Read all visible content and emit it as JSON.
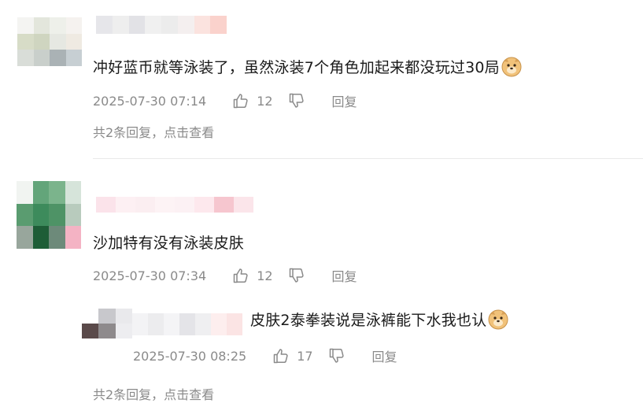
{
  "comments": [
    {
      "content": "冲好蓝币就等泳装了，虽然泳装7个角色加起来都没玩过30局",
      "time": "2025-07-30 07:14",
      "likes": "12",
      "reply_label": "回复",
      "replies_link": "共2条回复，点击查看",
      "avatar_colors": [
        "#f4f4f2",
        "#e3e6dc",
        "#eef0ea",
        "#f5f2ef",
        "#d7dcc7",
        "#cfd5c0",
        "#e6e8e2",
        "#efeae2",
        "#d9ddd8",
        "#c9cfcb",
        "#aab2b5",
        "#c7cfd3"
      ],
      "name_colors": [
        "#e6e6ea",
        "#eeeeee",
        "#e2e2e6",
        "#f0f0f0",
        "#ececec",
        "#f4efef",
        "#fbe3df",
        "#fad2cc"
      ]
    },
    {
      "content": "沙加特有没有泳装皮肤",
      "time": "2025-07-30 07:34",
      "likes": "12",
      "reply_label": "回复",
      "replies_link": "共2条回复，点击查看",
      "avatar_colors": [
        "#f1f4f1",
        "#63a57a",
        "#7bb48c",
        "#d6e4da",
        "#5a9c70",
        "#3d8b5c",
        "#4e9366",
        "#b8cbbd",
        "#98a69c",
        "#1e5d37",
        "#6d8a7a",
        "#f4b3c4"
      ],
      "name_colors": [
        "#fbe3ea",
        "#fdf0f3",
        "#fbeef1",
        "#fdf3f5",
        "#fcf1f4",
        "#fde8ed",
        "#f6c6cf",
        "#fbe5ea"
      ],
      "subreply": {
        "content": "皮肤2泰拳装说是泳裤能下水我也认",
        "time": "2025-07-30 08:25",
        "likes": "17",
        "reply_label": "回复",
        "avatar_colors": [
          "#ffffff",
          "#c8c8cc",
          "#e9e9ec",
          "#5a4a4a",
          "#8e8a8c",
          "#ededf0"
        ],
        "name_colors": [
          "#f3f3f5",
          "#ececee",
          "#f4f4f6",
          "#e4e4e8",
          "#efeff1",
          "#fdeeee",
          "#fbe4e4"
        ]
      }
    }
  ]
}
